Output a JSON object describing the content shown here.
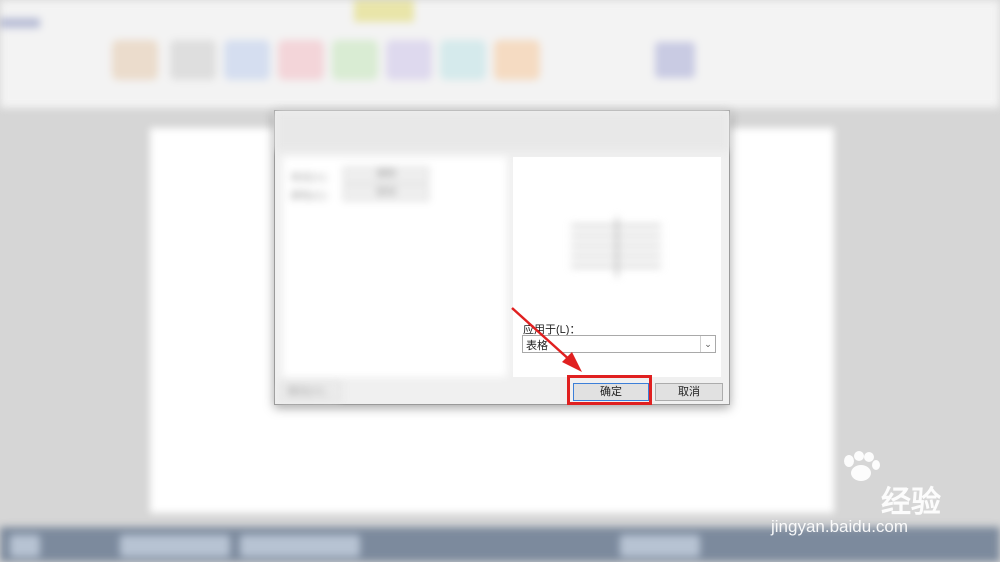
{
  "ribbon": {
    "group_colors": [
      "#e9d7c4",
      "#d9d9d9",
      "#cfd9ee",
      "#f2cfd3",
      "#d3eacd",
      "#d9d3ec",
      "#cfe7ea",
      "#f5d6b8"
    ]
  },
  "dialog": {
    "left_panel": {
      "style_label": "样式(Y)：",
      "style_value": "清除",
      "color_label": "颜色(C)：",
      "color_value": "自动"
    },
    "apply_to": {
      "label": "应用于(L)：",
      "value": "表格",
      "arrow": "⌄"
    },
    "buttons": {
      "ok": "确定",
      "cancel": "取消",
      "border": "横线(H)..."
    }
  },
  "watermark": {
    "brand": "Bai",
    "brand_cn": "经验",
    "url": "jingyan.baidu.com",
    "paw_color": "#ffffff"
  },
  "annotation": {
    "color": "#e02020"
  }
}
